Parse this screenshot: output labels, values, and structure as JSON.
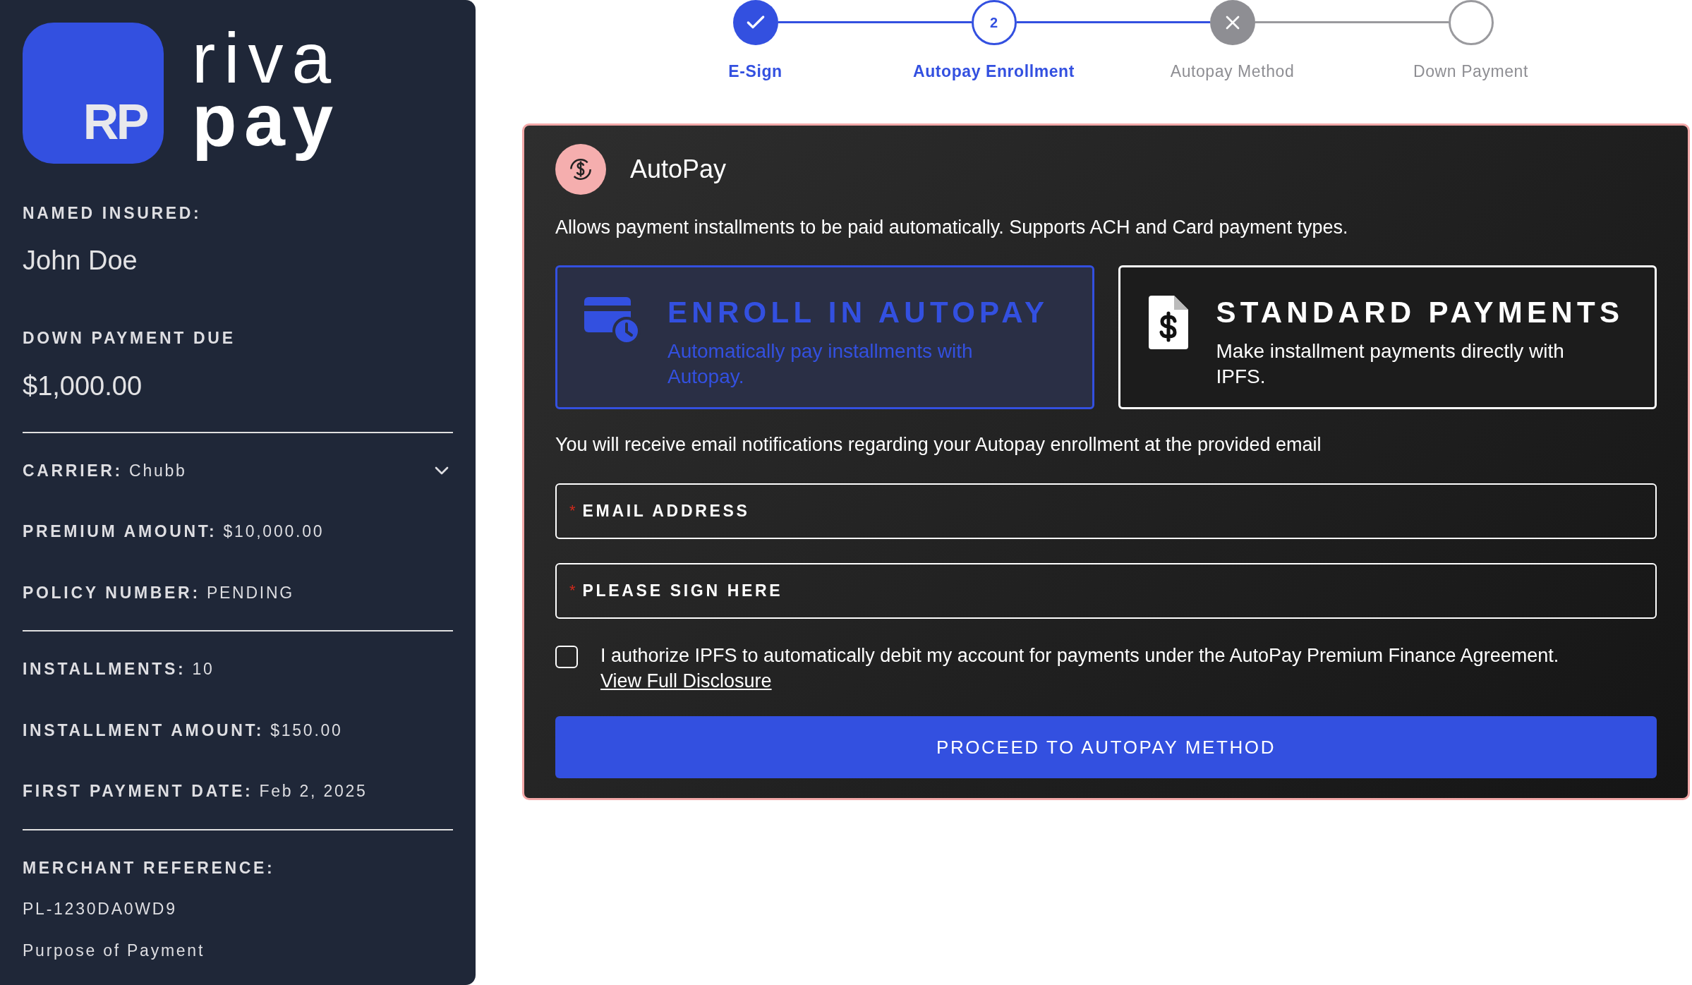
{
  "brand": {
    "badge": "RP",
    "word_top": "riva",
    "word_bottom": "pay"
  },
  "sidebar": {
    "headline": [
      {
        "label": "NAMED INSURED:",
        "value": "John Doe"
      },
      {
        "label": "DOWN PAYMENT DUE",
        "value": "$1,000.00"
      }
    ],
    "groups": [
      [
        {
          "label": "CARRIER:",
          "value": "Chubb",
          "kind": "dropdown"
        },
        {
          "label": "PREMIUM AMOUNT:",
          "value": "$10,000.00",
          "kind": "text"
        },
        {
          "label": "POLICY NUMBER:",
          "value": "PENDING",
          "kind": "text"
        }
      ],
      [
        {
          "label": "INSTALLMENTS:",
          "value": "10",
          "kind": "text"
        },
        {
          "label": "INSTALLMENT AMOUNT:",
          "value": "$150.00",
          "kind": "text"
        },
        {
          "label": "FIRST PAYMENT DATE:",
          "value": "Feb 2, 2025",
          "kind": "text"
        }
      ]
    ],
    "merchant": {
      "label": "MERCHANT REFERENCE:",
      "lines": [
        "PL-1230DA0WD9",
        "Purpose of Payment"
      ]
    }
  },
  "steps": [
    {
      "label": "E-Sign",
      "completed": true,
      "failed": false,
      "selected": false
    },
    {
      "label": "Autopay Enrollment",
      "completed": false,
      "failed": false,
      "selected": true,
      "number": "2"
    },
    {
      "label": "Autopay Method",
      "completed": false,
      "failed": true,
      "selected": false
    },
    {
      "label": "Down Payment",
      "completed": false,
      "failed": false,
      "selected": false
    }
  ],
  "card": {
    "title": "AutoPay",
    "description": "Allows payment installments to be paid automatically. Supports ACH and Card payment types.",
    "options": [
      {
        "title": "ENROLL IN AUTOPAY",
        "text": "Automatically pay installments with Autopay.",
        "kind": "autopay",
        "selected": true
      },
      {
        "title": "STANDARD PAYMENTS",
        "text": "Make installment payments directly with IPFS.",
        "kind": "standard",
        "selected": false
      }
    ],
    "notice": "You will receive email notifications regarding your Autopay enrollment at the provided email",
    "fields": [
      {
        "label": "EMAIL ADDRESS",
        "marker": "*"
      },
      {
        "label": "PLEASE SIGN HERE",
        "marker": "*"
      }
    ],
    "consent": {
      "text": "I authorize IPFS to automatically debit my account for payments under the AutoPay Premium Finance Agreement.",
      "link": "View Full Disclosure",
      "checked": false
    },
    "button": "PROCEED TO AUTOPAY METHOD"
  }
}
